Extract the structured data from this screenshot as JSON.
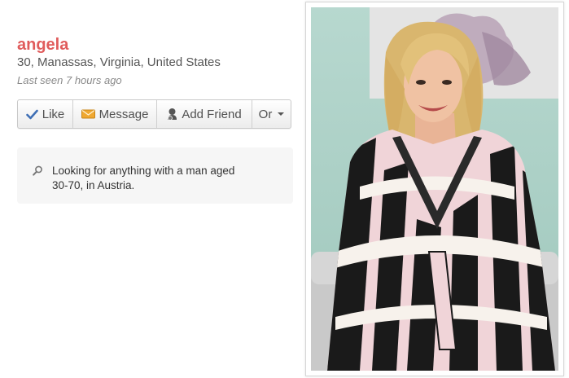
{
  "profile": {
    "name": "angela",
    "location": "30, Manassas, Virginia, United States",
    "last_seen": "Last seen 7 hours ago"
  },
  "actions": {
    "like": "Like",
    "message": "Message",
    "add_friend": "Add Friend",
    "or": "Or"
  },
  "looking_for": {
    "text": "Looking for anything with a man aged 30-70, in Austria."
  },
  "photo": {
    "alt": "Profile photo of a blonde woman in a black, white and pink patterned wrap dress"
  },
  "colors": {
    "name": "#e05c5c",
    "like_icon": "#3f6fb5",
    "message_icon": "#f0a830"
  },
  "icons": {
    "like": "checkmark-icon",
    "message": "envelope-icon",
    "add_friend": "person-icon",
    "or": "caret-down-icon",
    "looking_for": "magnifier-icon"
  }
}
